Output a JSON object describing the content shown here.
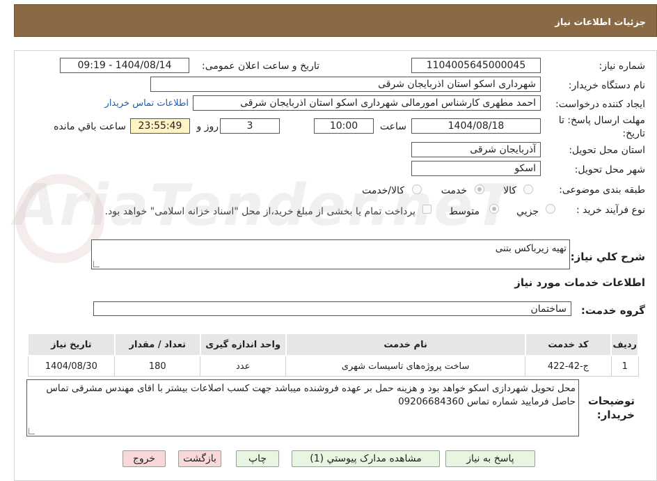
{
  "header": {
    "title": "جزئیات اطلاعات نیاز"
  },
  "watermark": {
    "text": "AriaTender.neT"
  },
  "form": {
    "need_number_label": "شماره نیاز:",
    "need_number": "1104005645000045",
    "announce_label": "تاریخ و ساعت اعلان عمومی:",
    "announce_value": "1404/08/14 - 09:19",
    "buyer_org_label": "نام دستگاه خریدار:",
    "buyer_org": "شهرداری اسکو استان اذربایجان شرقی",
    "requester_label": "ایجاد کننده درخواست:",
    "requester": "احمد مطهری کارشناس امورمالی شهرداری اسکو استان اذربایجان شرقی",
    "buyer_contact_link": "اطلاعات تماس خریدار",
    "deadline_label_1": "مهلت ارسال پاسخ: تا",
    "deadline_label_2": "تاریخ:",
    "deadline_date": "1404/08/18",
    "time_label": "ساعت",
    "deadline_time": "10:00",
    "days": "3",
    "days_label": "روز و",
    "remaining_time": "23:55:49",
    "remaining_label": "ساعت باقي مانده",
    "province_label": "استان محل تحویل:",
    "province": "آذربایجان شرقی",
    "city_label": "شهر محل تحویل:",
    "city": "اسکو",
    "category_label": "طبقه بندی موضوعی:",
    "category_options": [
      "کالا",
      "خدمت",
      "کالا/خدمت"
    ],
    "category_selected": "خدمت",
    "process_label": "نوع فرآیند خرید :",
    "process_options": [
      "جزيي",
      "متوسط"
    ],
    "process_selected": "متوسط",
    "payment_note": "پرداخت تمام یا بخشی از مبلغ خرید،از محل \"اسناد خزانه اسلامی\" خواهد بود."
  },
  "summary": {
    "label": "شرح کلي نیاز:",
    "value": "تهیه زیرباکس بتنی"
  },
  "services": {
    "section_title": "اطلاعات خدمات مورد نیاز",
    "group_label": "گروه خدمت:",
    "group_value": "ساختمان",
    "columns": [
      "ردیف",
      "کد خدمت",
      "نام خدمت",
      "واحد اندازه گیری",
      "تعداد / مقدار",
      "تاریخ نیاز"
    ],
    "rows": [
      [
        "1",
        "ج-42-422",
        "ساخت پروژه‌های تاسیسات شهری",
        "عدد",
        "180",
        "1404/08/30"
      ]
    ]
  },
  "buyer_notes": {
    "label_1": "توضیحات",
    "label_2": "خریدار:",
    "text": "محل تحویل شهردازی اسکو خواهد بود و هزینه حمل بر عهده فروشنده میباشد جهت کسب اصلاعات بیشتر با اقای مهندس مشرقی تماس حاصل فرمایید شماره تماس 09206684360"
  },
  "buttons": {
    "respond": "پاسخ به نیاز",
    "view_docs": "مشاهده مدارک پیوستي (1)",
    "print": "چاپ",
    "back": "بازگشت",
    "exit": "خروج"
  }
}
